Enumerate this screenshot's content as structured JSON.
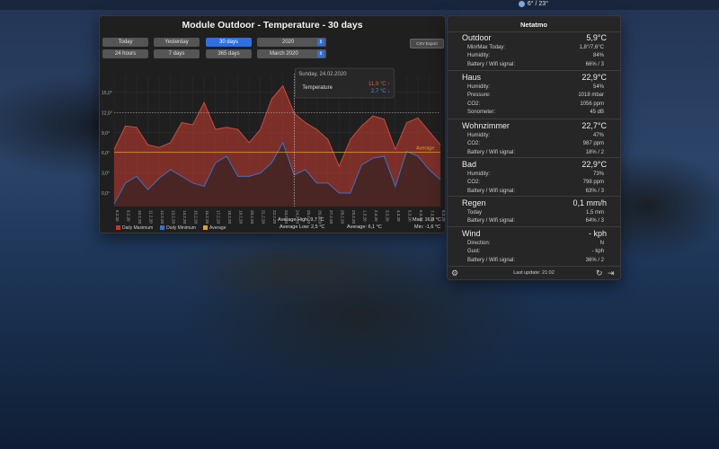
{
  "menubar": {
    "weather": "6° / 23°"
  },
  "chart_window": {
    "title": "Module Outdoor - Temperature - 30 days",
    "buttons_row1": [
      "Today",
      "Yesterday",
      "30 days"
    ],
    "buttons_row2": [
      "24 hours",
      "7 days",
      "365 days"
    ],
    "active_button": "30 days",
    "year_select": "2020",
    "month_select": "March 2020",
    "csv_button": "CSV Export",
    "tooltip": {
      "date": "Sunday, 24.02.2020",
      "label": "Temperature",
      "high": "11,9 °C ↑",
      "low": "2,7 °C ↓"
    },
    "average_label": "Average",
    "stats": {
      "avg_high": "Average High: 9,7 °C",
      "avg_low": "Average Low: 2,5 °C",
      "average": "Average: 6,1 °C",
      "max": "Max: 16,0 °C",
      "min": "Min: -1,6 °C"
    },
    "legend": [
      "Daily Maximum",
      "Daily Minimum",
      "Average"
    ],
    "colors": {
      "max": "#c0392b",
      "min": "#3a72c8",
      "avg": "#e0a030"
    }
  },
  "chart_data": {
    "type": "area",
    "x": [
      "8.2.20",
      "9.2.20",
      "10.2.20",
      "11.2.20",
      "12.2.20",
      "13.2.20",
      "14.2.20",
      "15.2.20",
      "16.2.20",
      "17.2.20",
      "18.2.20",
      "19.2.20",
      "20.2.20",
      "21.2.20",
      "22.2.20",
      "23.2.20",
      "24.2.20",
      "25.2.20",
      "26.2.20",
      "27.2.20",
      "28.2.20",
      "29.2.20",
      "1.3.20",
      "2.3.20",
      "3.3.20",
      "4.3.20",
      "5.3.20",
      "6.3.20",
      "7.3.20",
      "8.3.20"
    ],
    "yticks": [
      "0,0°",
      "3,0°",
      "6,0°",
      "9,0°",
      "12,0°",
      "15,0°"
    ],
    "ylim": [
      -2,
      17
    ],
    "series": [
      {
        "name": "Daily Maximum",
        "values": [
          6.5,
          10,
          9.8,
          7.2,
          6.8,
          7.5,
          10.5,
          10.2,
          13.5,
          9.5,
          9.8,
          9.5,
          7.5,
          9.5,
          14,
          16,
          11.9,
          10.5,
          9.5,
          8,
          4,
          8,
          10,
          11.5,
          11,
          6.5,
          10.5,
          11.2,
          9.2,
          7.2
        ]
      },
      {
        "name": "Daily Minimum",
        "values": [
          -1.6,
          1.5,
          2.5,
          0.5,
          2.2,
          3.5,
          2.5,
          1.5,
          1,
          4.5,
          5.5,
          2.5,
          2.5,
          3,
          4.5,
          7.5,
          2.7,
          3.5,
          1.5,
          1.5,
          0,
          0,
          4.2,
          5.2,
          5.5,
          1,
          6.2,
          5.5,
          3.5,
          2
        ]
      },
      {
        "name": "Average",
        "values": [
          6.1,
          6.1,
          6.1,
          6.1,
          6.1,
          6.1,
          6.1,
          6.1,
          6.1,
          6.1,
          6.1,
          6.1,
          6.1,
          6.1,
          6.1,
          6.1,
          6.1,
          6.1,
          6.1,
          6.1,
          6.1,
          6.1,
          6.1,
          6.1,
          6.1,
          6.1,
          6.1,
          6.1,
          6.1,
          6.1
        ]
      }
    ],
    "reference_line": 12,
    "highlight_x": "24.2.20",
    "grid": true
  },
  "panel": {
    "title": "Netatmo",
    "modules": [
      {
        "name": "Outdoor",
        "value": "5,9°C",
        "rows": [
          [
            "Min/Max Today:",
            "1,8°/7,6°C"
          ],
          [
            "Humidity:",
            "84%"
          ],
          [
            "Battery / Wifi signal:",
            "66% / 3"
          ]
        ]
      },
      {
        "name": "Haus",
        "value": "22,9°C",
        "rows": [
          [
            "Humidity:",
            "54%"
          ],
          [
            "Pressure:",
            "1018 mbar"
          ],
          [
            "CO2:",
            "1056 ppm"
          ],
          [
            "Sonometer:",
            "45 dB"
          ]
        ]
      },
      {
        "name": "Wohnzimmer",
        "value": "22,7°C",
        "rows": [
          [
            "Humidity:",
            "47%"
          ],
          [
            "CO2:",
            "987 ppm"
          ],
          [
            "Battery / Wifi signal:",
            "18% / 2"
          ]
        ]
      },
      {
        "name": "Bad",
        "value": "22,9°C",
        "rows": [
          [
            "Humidity:",
            "73%"
          ],
          [
            "CO2:",
            "798 ppm"
          ],
          [
            "Battery / Wifi signal:",
            "63% / 3"
          ]
        ]
      },
      {
        "name": "Regen",
        "value": "0,1 mm/h",
        "rows": [
          [
            "Today",
            "1,5 mm"
          ],
          [
            "Battery / Wifi signal:",
            "64% / 3"
          ]
        ]
      },
      {
        "name": "Wind",
        "value": "- kph",
        "rows": [
          [
            "Direction:",
            "N"
          ],
          [
            "Gust:",
            "- kph"
          ],
          [
            "Battery / Wifi signal:",
            "36% / 2"
          ]
        ]
      }
    ],
    "last_update": "Last update: 21:02",
    "icons": {
      "settings": "gear-icon",
      "refresh": "refresh-icon",
      "exit": "exit-icon"
    }
  }
}
